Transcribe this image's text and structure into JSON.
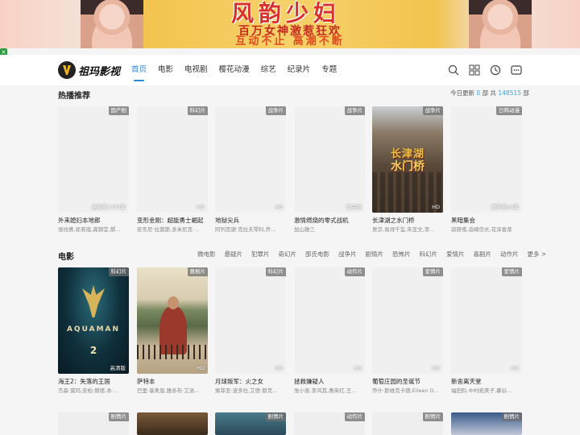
{
  "banner": {
    "title": "风韵少妇",
    "line1": "百万女神激惹狂欢",
    "line2": "互动不止 高潮不断"
  },
  "header": {
    "logo_text": "祖玛影视",
    "nav": [
      "首页",
      "电影",
      "电视剧",
      "樱花动漫",
      "综艺",
      "纪录片",
      "专题"
    ],
    "icons": [
      "search-icon",
      "grid-icon",
      "history-icon",
      "message-icon"
    ]
  },
  "hot": {
    "title": "热播推荐",
    "update_prefix": "今日更新",
    "update_count": "0",
    "update_mid": "部 共",
    "total_count": "148515",
    "update_suffix": "部",
    "items": [
      {
        "badge": "国产剧",
        "foot": "连载至1335集",
        "title": "外来媳妇本地郎",
        "cast": "张纹携,徐若瑄,龚锦堂,郝..."
      },
      {
        "badge": "科幻片",
        "foot": "HD",
        "title": "变形金刚：超能勇士崛起",
        "cast": "安东尼·拉莫斯,多米尼克·..."
      },
      {
        "badge": "战争片",
        "foot": "HD",
        "title": "地狱尖兵",
        "cast": "阿列克谢·克拉夫琴科,乔..."
      },
      {
        "badge": "战争片",
        "foot": "已完结",
        "title": "激情燃烧的零式战机",
        "cast": "加山雄三"
      },
      {
        "badge": "战争片",
        "foot": "HD",
        "title": "长津湖之水门桥",
        "cast": "吴京,易烊千玺,朱亚文,李..."
      },
      {
        "badge": "日韩动漫",
        "foot": "更新至24集",
        "title": "黑暗集会",
        "cast": "寂原侑,岳崎信长,花泽香菜"
      }
    ]
  },
  "movies": {
    "title": "电影",
    "categories": [
      "微电影",
      "悬疑片",
      "犯罪片",
      "奇幻片",
      "邵氏电影",
      "战争片",
      "剧情片",
      "恐怖片",
      "科幻片",
      "爱情片",
      "喜剧片",
      "动作片",
      "更多 >"
    ],
    "items": [
      {
        "badge": "科幻片",
        "foot": "高清版",
        "title": "海王2：失落的王国",
        "cast": "杰森·莫玛,安柏·赫德,本·..."
      },
      {
        "badge": "喜剧片",
        "foot": "HD",
        "title": "萨特本",
        "cast": "巴里·基奥恩,雅各布·艾洛..."
      },
      {
        "badge": "科幻片",
        "foot": "HD",
        "title": "月球叛军：火之女",
        "cast": "索菲亚·波多拉,艾德·斯克..."
      },
      {
        "badge": "动作片",
        "foot": "HD",
        "title": "拯救嫌疑人",
        "cast": "张小斐,李鸿其,惠英红,王..."
      },
      {
        "badge": "爱情片",
        "foot": "HD",
        "title": "葡萄庄园的圣诞节",
        "cast": "乔什·斯维克卡德,Eileen D..."
      },
      {
        "badge": "爱情片",
        "foot": "HD",
        "title": "新舍离天堂",
        "cast": "福田鈴,中村拓美子,寡谷..."
      }
    ],
    "next_row_badges": [
      "剧情片",
      "",
      "剧情片",
      "动作片",
      "剧情片",
      "剧情片"
    ]
  },
  "posters": {
    "war_title_1": "长津湖",
    "war_title_2": "水门桥",
    "aqua_name": "AQUAMAN",
    "aqua_num": "2"
  }
}
